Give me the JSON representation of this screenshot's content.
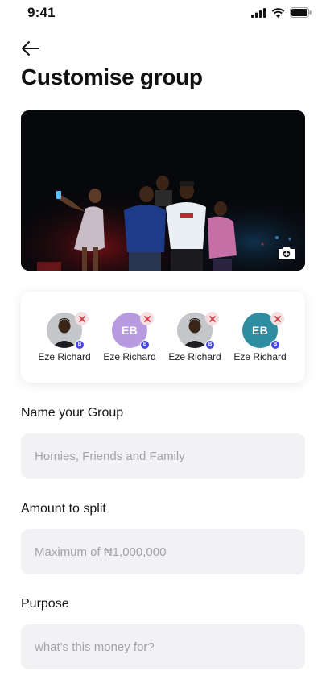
{
  "status_bar": {
    "time": "9:41"
  },
  "header": {
    "title": "Customise group"
  },
  "members": [
    {
      "name": "Eze Richard",
      "avatar_type": "photo",
      "initials": "",
      "avatar_color": "",
      "badge": "B"
    },
    {
      "name": "Eze Richard",
      "avatar_type": "initials",
      "initials": "EB",
      "avatar_color": "#b79ae0",
      "badge": "B"
    },
    {
      "name": "Eze Richard",
      "avatar_type": "photo",
      "initials": "",
      "avatar_color": "",
      "badge": "B"
    },
    {
      "name": "Eze Richard",
      "avatar_type": "initials",
      "initials": "EB",
      "avatar_color": "#2f8da2",
      "badge": "B"
    }
  ],
  "form": {
    "group_name": {
      "label": "Name your Group",
      "placeholder": "Homies, Friends and Family",
      "value": ""
    },
    "amount": {
      "label": "Amount to split",
      "placeholder": "Maximum of ₦1,000,000",
      "value": ""
    },
    "purpose": {
      "label": "Purpose",
      "placeholder": "what's this money for?",
      "value": ""
    }
  },
  "colors": {
    "accent": "#4747e6",
    "input_bg": "#f2f2f5",
    "remove_badge_bg": "#f3dfe0",
    "remove_icon": "#d33a45"
  },
  "icons": {
    "back": "arrow-left-icon",
    "camera": "camera-plus-icon",
    "remove": "close-icon"
  }
}
